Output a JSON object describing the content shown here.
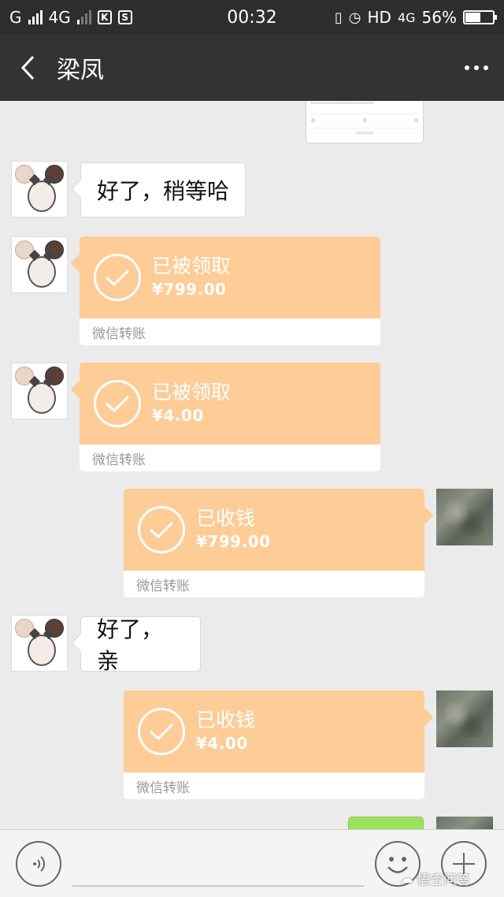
{
  "status_bar": {
    "carrier": "G",
    "network": "4G",
    "time": "00:32",
    "hd": "HD",
    "network2": "4G",
    "battery": "56%",
    "battery_level": 0.56
  },
  "header": {
    "title": "梁凤"
  },
  "messages": {
    "text1": "好了，稍等哈",
    "transfer1": {
      "status": "已被领取",
      "amount": "¥799.00",
      "footer": "微信转账"
    },
    "transfer2": {
      "status": "已被领取",
      "amount": "¥4.00",
      "footer": "微信转账"
    },
    "transfer3": {
      "status": "已收钱",
      "amount": "¥799.00",
      "footer": "微信转账"
    },
    "text2": "好了，亲",
    "transfer4": {
      "status": "已收钱",
      "amount": "¥4.00",
      "footer": "微信转账"
    }
  },
  "watermark": "悟空问答",
  "colors": {
    "transfer_orange": "#fdcc97",
    "header_bg": "#333333",
    "chat_bg": "#ebebeb",
    "sent_green": "#9ee15c"
  }
}
